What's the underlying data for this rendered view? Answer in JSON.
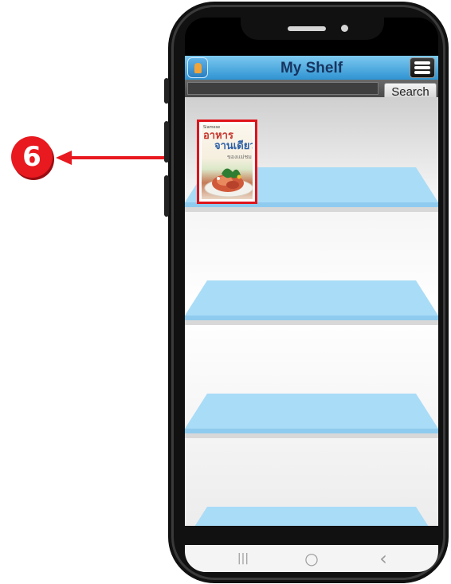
{
  "app": {
    "title": "My Shelf",
    "menu_icon": "list-menu-icon",
    "logo_icon": "app-logo-icon"
  },
  "search": {
    "value": "",
    "button_label": "Search"
  },
  "shelf": {
    "books": [
      {
        "publisher": "Siamese",
        "title_line1": "อาหาร",
        "title_line2": "จานเดียว",
        "title_line3": "ของแม่ชม"
      }
    ]
  },
  "callout": {
    "number": "6",
    "color": "#e8191f"
  },
  "navbar": {
    "recents": "|||",
    "home": "○",
    "back": "‹"
  },
  "colors": {
    "header_top": "#7cc9f0",
    "header_bottom": "#2f93d2",
    "shelf_board": "#9fd6f5",
    "highlight": "#e0141b"
  }
}
